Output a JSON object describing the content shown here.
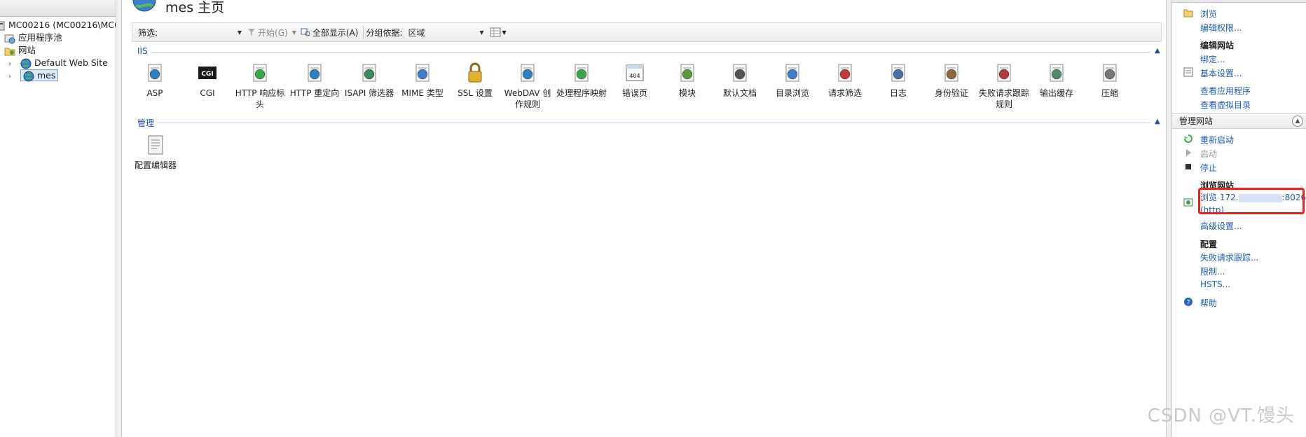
{
  "tree": {
    "server": "MC00216 (MC00216\\MC00",
    "app_pools": "应用程序池",
    "sites": "网站",
    "default_site": "Default Web Site",
    "mes": "mes"
  },
  "page": {
    "title": "mes 主页"
  },
  "filter": {
    "label": "筛选:",
    "input": "",
    "go": "开始(G)",
    "show_all": "全部显示(A)",
    "group_by_label": "分组依据:",
    "group_by_value": "区域"
  },
  "groups": {
    "iis": "IIS",
    "manage": "管理"
  },
  "iis_features": [
    {
      "label": "ASP",
      "icon": "asp-icon"
    },
    {
      "label": "CGI",
      "icon": "cgi-icon"
    },
    {
      "label": "HTTP 响应标头",
      "icon": "http-headers-icon"
    },
    {
      "label": "HTTP 重定向",
      "icon": "http-redirect-icon"
    },
    {
      "label": "ISAPI 筛选器",
      "icon": "isapi-filters-icon"
    },
    {
      "label": "MIME 类型",
      "icon": "mime-types-icon"
    },
    {
      "label": "SSL 设置",
      "icon": "ssl-lock-icon"
    },
    {
      "label": "WebDAV 创作规则",
      "icon": "webdav-icon"
    },
    {
      "label": "处理程序映射",
      "icon": "handler-mappings-icon"
    },
    {
      "label": "错误页",
      "icon": "error-pages-icon"
    },
    {
      "label": "模块",
      "icon": "modules-icon"
    },
    {
      "label": "默认文档",
      "icon": "default-document-icon"
    },
    {
      "label": "目录浏览",
      "icon": "directory-browsing-icon"
    },
    {
      "label": "请求筛选",
      "icon": "request-filtering-icon"
    },
    {
      "label": "日志",
      "icon": "logging-icon"
    },
    {
      "label": "身份验证",
      "icon": "authentication-icon"
    },
    {
      "label": "失败请求跟踪规则",
      "icon": "failed-request-tracing-icon"
    },
    {
      "label": "输出缓存",
      "icon": "output-caching-icon"
    },
    {
      "label": "压缩",
      "icon": "compression-icon"
    }
  ],
  "manage_features": [
    {
      "label": "配置编辑器",
      "icon": "configuration-editor-icon"
    }
  ],
  "actions": {
    "explore": "浏览",
    "edit_permissions": "编辑权限...",
    "edit_site_head": "编辑网站",
    "bindings": "绑定...",
    "basic_settings": "基本设置...",
    "view_apps": "查看应用程序",
    "view_vdirs": "查看虚拟目录",
    "manage_site_header": "管理网站",
    "restart": "重新启动",
    "start": "启动",
    "stop": "停止",
    "browse_site_head": "浏览网站",
    "browse_link_1": "浏览 172.",
    "browse_link_2": ":8026",
    "browse_link_3": "(http)",
    "advanced_settings": "高级设置...",
    "configure_head": "配置",
    "failed_tracing": "失败请求跟踪...",
    "limits": "限制...",
    "hsts": "HSTS...",
    "help": "帮助"
  },
  "watermark": "CSDN @VT.馒头",
  "colors": {
    "link": "#1f5bb8",
    "highlight_border": "#e8211b",
    "group_header": "#1f4e9e"
  }
}
